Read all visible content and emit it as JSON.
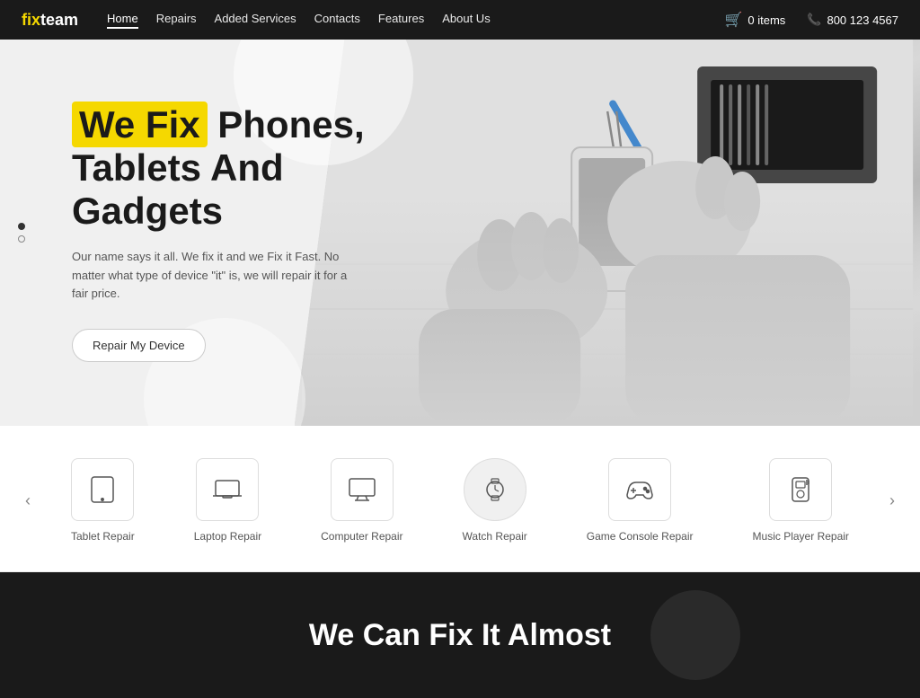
{
  "header": {
    "logo_fix": "fix",
    "logo_team": "team",
    "nav_items": [
      {
        "label": "Home",
        "active": true
      },
      {
        "label": "Repairs",
        "active": false
      },
      {
        "label": "Added Services",
        "active": false
      },
      {
        "label": "Contacts",
        "active": false
      },
      {
        "label": "Features",
        "active": false
      },
      {
        "label": "About Us",
        "active": false
      }
    ],
    "cart_label": "0 items",
    "phone": "800 123 4567"
  },
  "hero": {
    "title_highlight": "We Fix",
    "title_rest": " Phones,",
    "title_line2": "Tablets And",
    "title_line3": "Gadgets",
    "subtitle": "Our name says it all. We fix it and we Fix it Fast. No matter what type of device \"it\" is, we will repair it for a fair price.",
    "cta_label": "Repair My Device",
    "dots": [
      {
        "active": true
      },
      {
        "active": false
      }
    ]
  },
  "services": {
    "arrow_left": "‹",
    "arrow_right": "›",
    "items": [
      {
        "label": "Tablet Repair",
        "icon": "tablet"
      },
      {
        "label": "Laptop Repair",
        "icon": "laptop"
      },
      {
        "label": "Computer Repair",
        "icon": "monitor"
      },
      {
        "label": "Watch Repair",
        "icon": "watch",
        "active": true
      },
      {
        "label": "Game Console Repair",
        "icon": "gamepad"
      },
      {
        "label": "Music Player Repair",
        "icon": "music-player"
      }
    ]
  },
  "bottom": {
    "title": "We Can Fix It Almost"
  }
}
